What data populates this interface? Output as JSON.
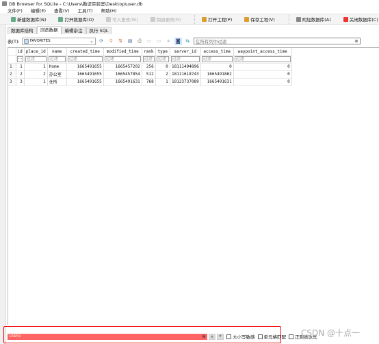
{
  "window": {
    "title": "DB Browser for SQLite - C:\\Users\\勘证实验室\\Desktop\\user.db"
  },
  "menu": [
    "文件(F)",
    "编辑(E)",
    "查看(V)",
    "工具(T)",
    "帮助(H)"
  ],
  "toolbar": [
    {
      "label": "新建数据库(N)",
      "enabled": true,
      "color": "#6a8"
    },
    {
      "label": "打开数据库(O)",
      "enabled": true,
      "color": "#6a8"
    },
    {
      "label": "写入更改(W)",
      "enabled": false,
      "color": "#ccc"
    },
    {
      "label": "倒退更改(R)",
      "enabled": false,
      "color": "#ccc"
    },
    {
      "label": "打开工程(P)",
      "enabled": true,
      "color": "#d9a030"
    },
    {
      "label": "保存工程(V)",
      "enabled": true,
      "color": "#d9a030"
    },
    {
      "label": "附加数据库(A)",
      "enabled": true,
      "color": "#888"
    },
    {
      "label": "关闭数据库(C)",
      "enabled": true,
      "color": "#e33"
    }
  ],
  "tabs": [
    {
      "label": "数据库结构"
    },
    {
      "label": "浏览数据",
      "active": true
    },
    {
      "label": "编辑杂注"
    },
    {
      "label": "执行 SQL"
    }
  ],
  "table_toolbar": {
    "table_label": "表(T):",
    "table_value": "FAVORITES",
    "filter_placeholder": "在所有列中过滤"
  },
  "grid": {
    "columns": [
      "id",
      "place_id",
      "name",
      "created_time",
      "modified_time",
      "rank",
      "type",
      "server_id",
      "access_time",
      "waypoint_access_time"
    ],
    "filter_placeholder": "过滤",
    "rows": [
      [
        "1",
        "1",
        "1",
        "Home",
        "1665491655",
        "1665457202",
        "256",
        "0",
        "18111494896",
        "0",
        "0"
      ],
      [
        "2",
        "2",
        "2",
        "办公室",
        "1665491655",
        "1665457854",
        "512",
        "2",
        "18111618743",
        "1665491862",
        "0"
      ],
      [
        "3",
        "3",
        "1",
        "住所",
        "1665491655",
        "1665491631",
        "768",
        "1",
        "18123737089",
        "1665491631",
        "0"
      ]
    ]
  },
  "find_bar": {
    "value": "16659",
    "match_case": "大小写敏感",
    "whole_cell": "单元格匹配",
    "regex": "正则表达式",
    "highlight_color": "#ff6464"
  },
  "watermark": "CSDN @十点一"
}
